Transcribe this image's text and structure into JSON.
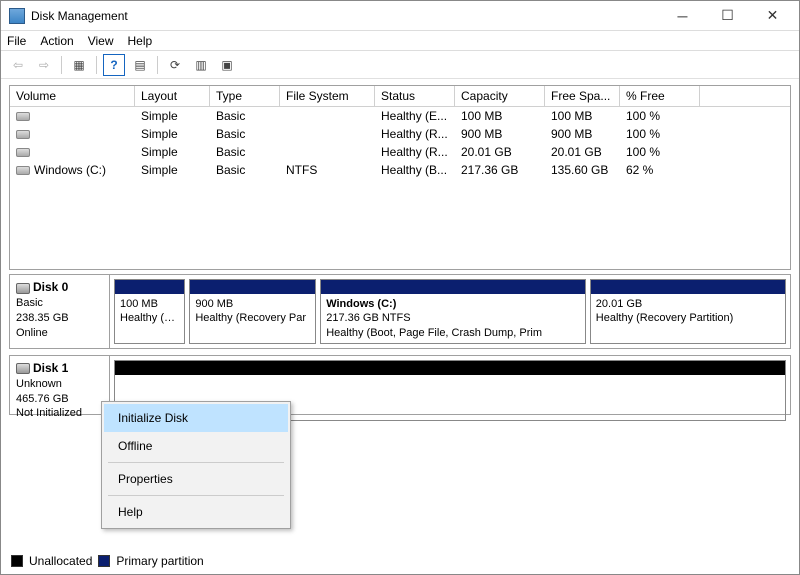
{
  "window": {
    "title": "Disk Management"
  },
  "menu": {
    "file": "File",
    "action": "Action",
    "view": "View",
    "help": "Help"
  },
  "volumes": {
    "headers": {
      "volume": "Volume",
      "layout": "Layout",
      "type": "Type",
      "fs": "File System",
      "status": "Status",
      "capacity": "Capacity",
      "free": "Free Spa...",
      "pfree": "% Free"
    },
    "rows": [
      {
        "volume": "",
        "layout": "Simple",
        "type": "Basic",
        "fs": "",
        "status": "Healthy (E...",
        "capacity": "100 MB",
        "free": "100 MB",
        "pfree": "100 %"
      },
      {
        "volume": "",
        "layout": "Simple",
        "type": "Basic",
        "fs": "",
        "status": "Healthy (R...",
        "capacity": "900 MB",
        "free": "900 MB",
        "pfree": "100 %"
      },
      {
        "volume": "",
        "layout": "Simple",
        "type": "Basic",
        "fs": "",
        "status": "Healthy (R...",
        "capacity": "20.01 GB",
        "free": "20.01 GB",
        "pfree": "100 %"
      },
      {
        "volume": "Windows (C:)",
        "layout": "Simple",
        "type": "Basic",
        "fs": "NTFS",
        "status": "Healthy (B...",
        "capacity": "217.36 GB",
        "free": "135.60 GB",
        "pfree": "62 %"
      }
    ]
  },
  "disks": [
    {
      "name": "Disk 0",
      "type": "Basic",
      "size": "238.35 GB",
      "state": "Online",
      "parts": [
        {
          "title": "",
          "line2": "100 MB",
          "line3": "Healthy (EFI S",
          "flex": 10,
          "kind": "primary"
        },
        {
          "title": "",
          "line2": "900 MB",
          "line3": "Healthy (Recovery Par",
          "flex": 18,
          "kind": "primary"
        },
        {
          "title": "Windows  (C:)",
          "line2": "217.36 GB NTFS",
          "line3": "Healthy (Boot, Page File, Crash Dump, Prim",
          "flex": 38,
          "kind": "primary"
        },
        {
          "title": "",
          "line2": "20.01 GB",
          "line3": "Healthy (Recovery Partition)",
          "flex": 28,
          "kind": "primary"
        }
      ]
    },
    {
      "name": "Disk 1",
      "type": "Unknown",
      "size": "465.76 GB",
      "state": "Not Initialized",
      "parts": [
        {
          "title": "",
          "line2": "",
          "line3": "",
          "flex": 100,
          "kind": "unallocated"
        }
      ]
    }
  ],
  "legend": {
    "unallocated": "Unallocated",
    "primary": "Primary partition"
  },
  "context_menu": {
    "initialize": "Initialize Disk",
    "offline": "Offline",
    "properties": "Properties",
    "help": "Help"
  }
}
